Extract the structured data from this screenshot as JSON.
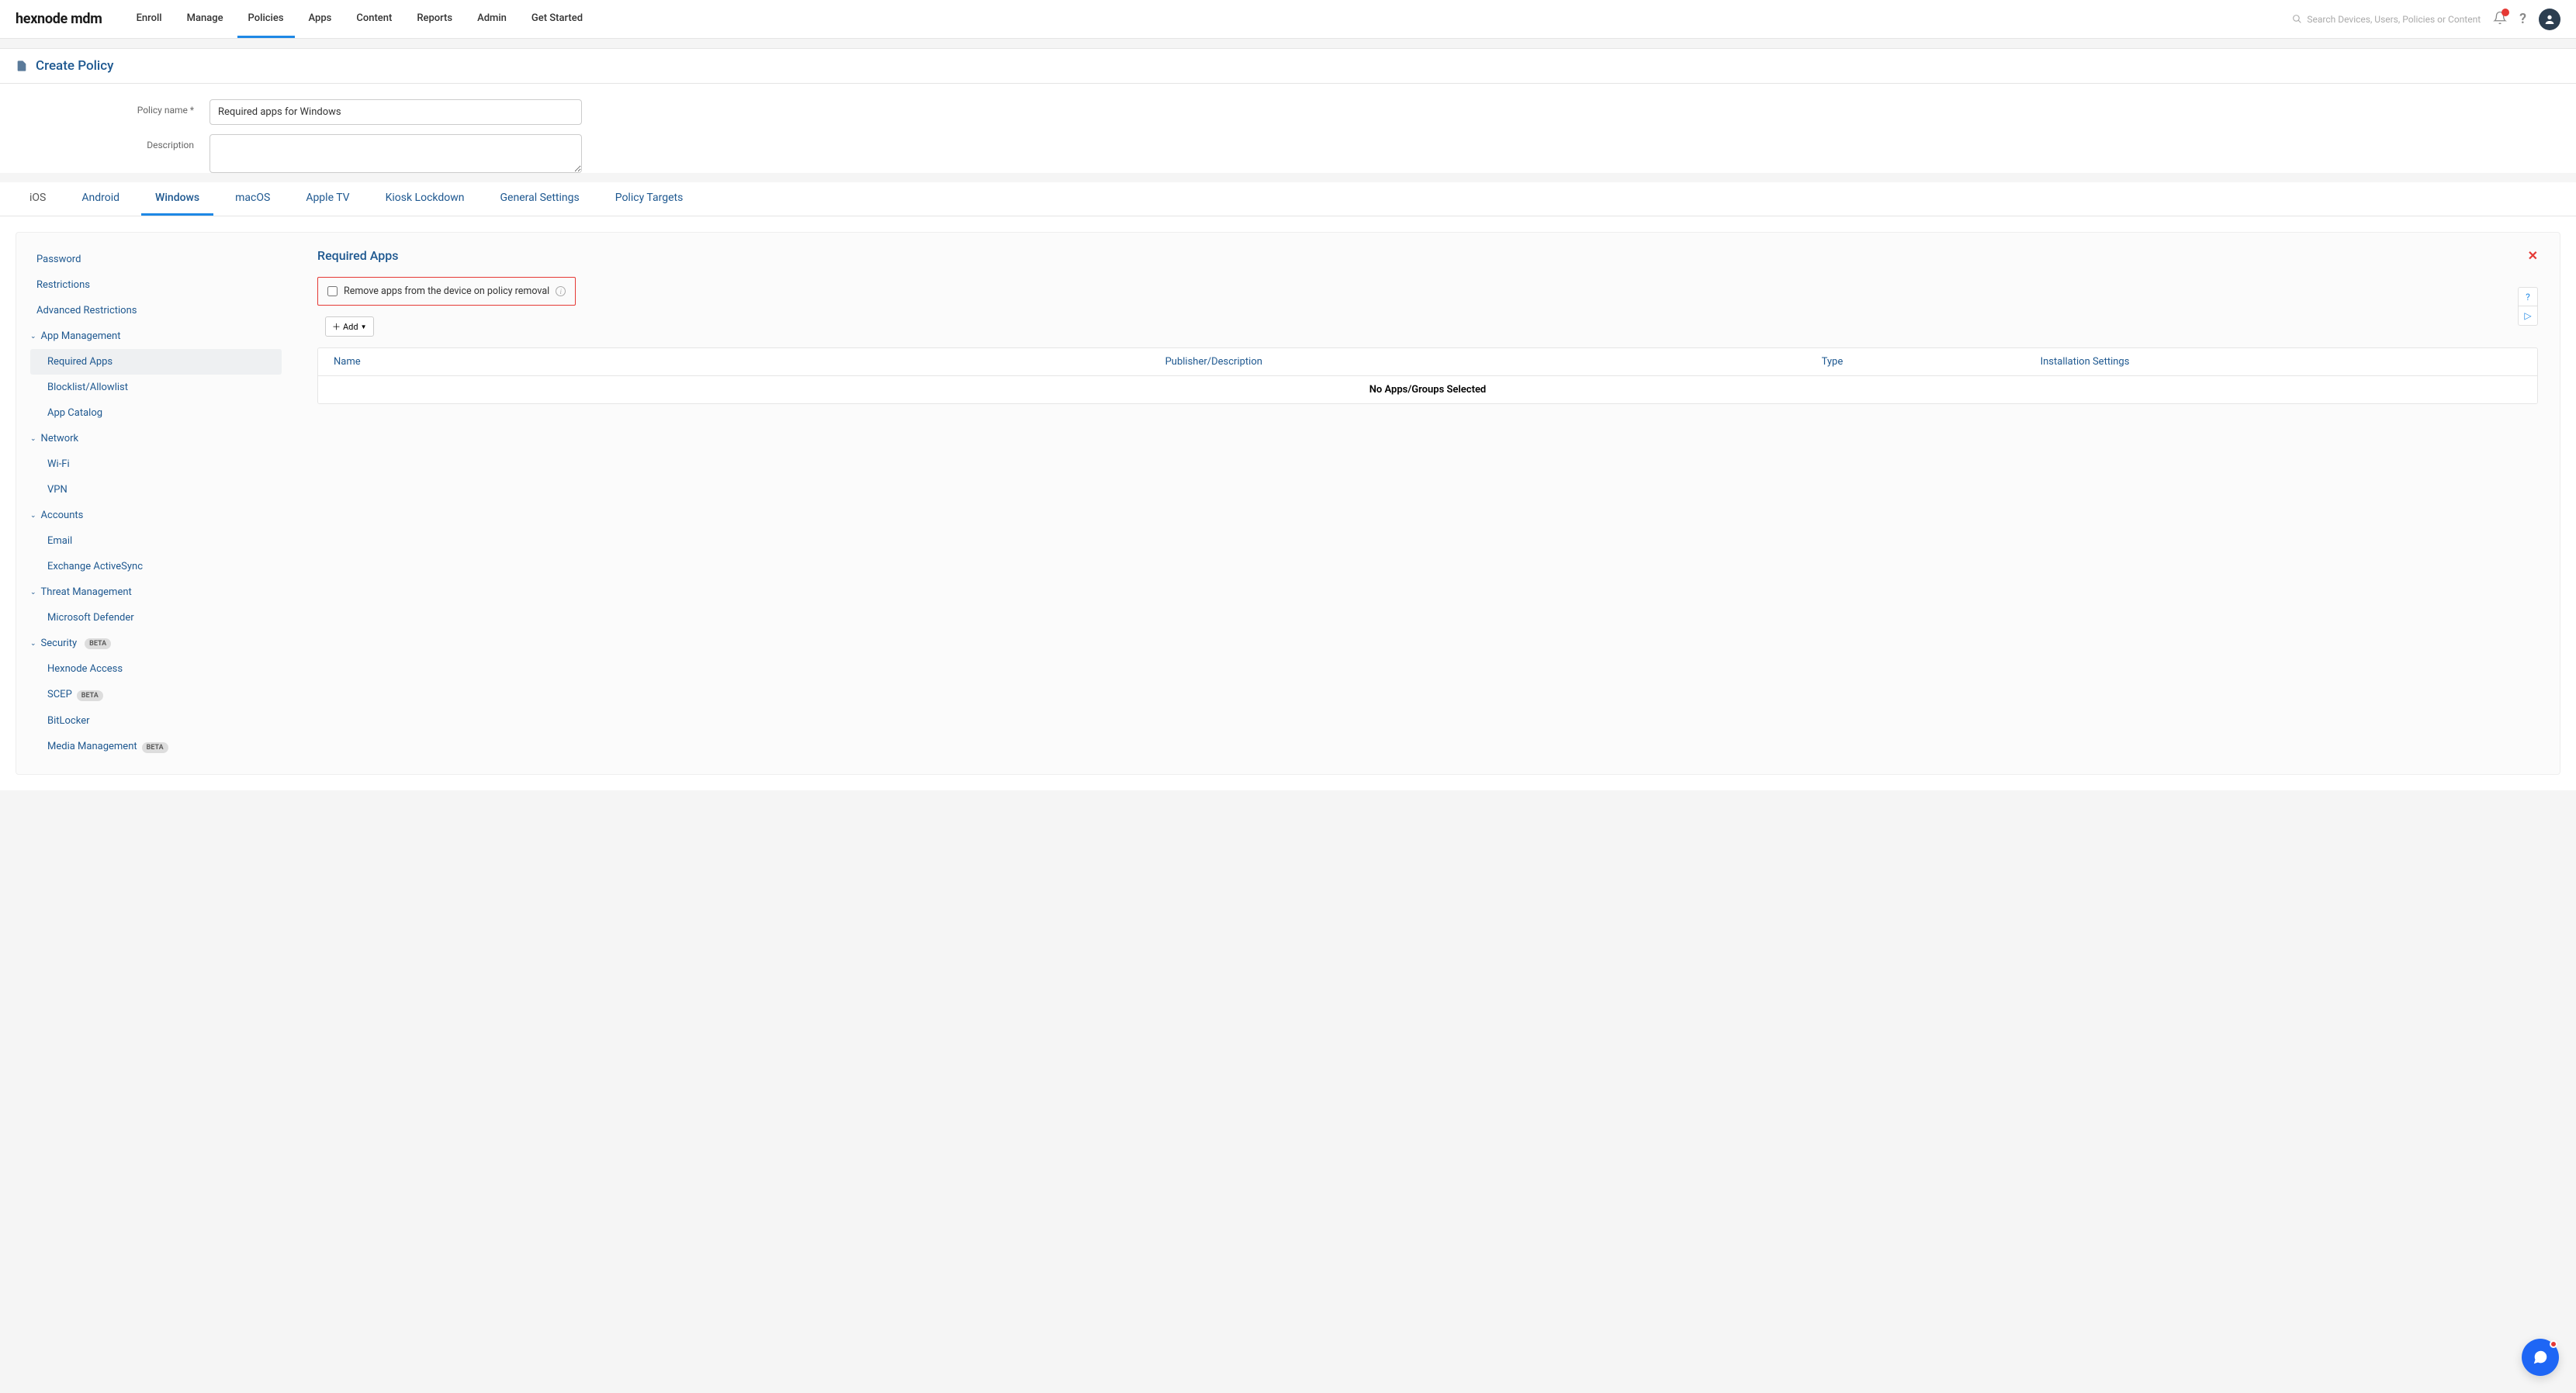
{
  "brand": "hexnode mdm",
  "nav": {
    "items": [
      "Enroll",
      "Manage",
      "Policies",
      "Apps",
      "Content",
      "Reports",
      "Admin",
      "Get Started"
    ],
    "active_index": 2
  },
  "search": {
    "placeholder": "Search Devices, Users, Policies or Content"
  },
  "page_title": "Create Policy",
  "form": {
    "policy_name_label": "Policy name *",
    "policy_name_value": "Required apps for Windows",
    "description_label": "Description",
    "description_value": ""
  },
  "platform_tabs": {
    "items": [
      "iOS",
      "Android",
      "Windows",
      "macOS",
      "Apple TV",
      "Kiosk Lockdown",
      "General Settings",
      "Policy Targets"
    ],
    "active_index": 2
  },
  "sidebar": {
    "items": [
      {
        "type": "item",
        "label": "Password"
      },
      {
        "type": "item",
        "label": "Restrictions"
      },
      {
        "type": "item",
        "label": "Advanced Restrictions"
      },
      {
        "type": "group",
        "label": "App Management",
        "children": [
          {
            "label": "Required Apps",
            "active": true
          },
          {
            "label": "Blocklist/Allowlist"
          },
          {
            "label": "App Catalog"
          }
        ]
      },
      {
        "type": "group",
        "label": "Network",
        "children": [
          {
            "label": "Wi-Fi"
          },
          {
            "label": "VPN"
          }
        ]
      },
      {
        "type": "group",
        "label": "Accounts",
        "children": [
          {
            "label": "Email"
          },
          {
            "label": "Exchange ActiveSync"
          }
        ]
      },
      {
        "type": "group",
        "label": "Threat Management",
        "children": [
          {
            "label": "Microsoft Defender"
          }
        ]
      },
      {
        "type": "group",
        "label": "Security",
        "badge": "BETA",
        "children": [
          {
            "label": "Hexnode Access"
          },
          {
            "label": "SCEP",
            "badge": "BETA"
          },
          {
            "label": "BitLocker"
          },
          {
            "label": "Media Management",
            "badge": "BETA"
          }
        ]
      }
    ]
  },
  "pane": {
    "title": "Required Apps",
    "checkbox_label": "Remove apps from the device on policy removal",
    "add_button": "Add",
    "columns": {
      "name": "Name",
      "publisher": "Publisher/Description",
      "type": "Type",
      "install": "Installation Settings"
    },
    "empty": "No Apps/Groups Selected"
  }
}
